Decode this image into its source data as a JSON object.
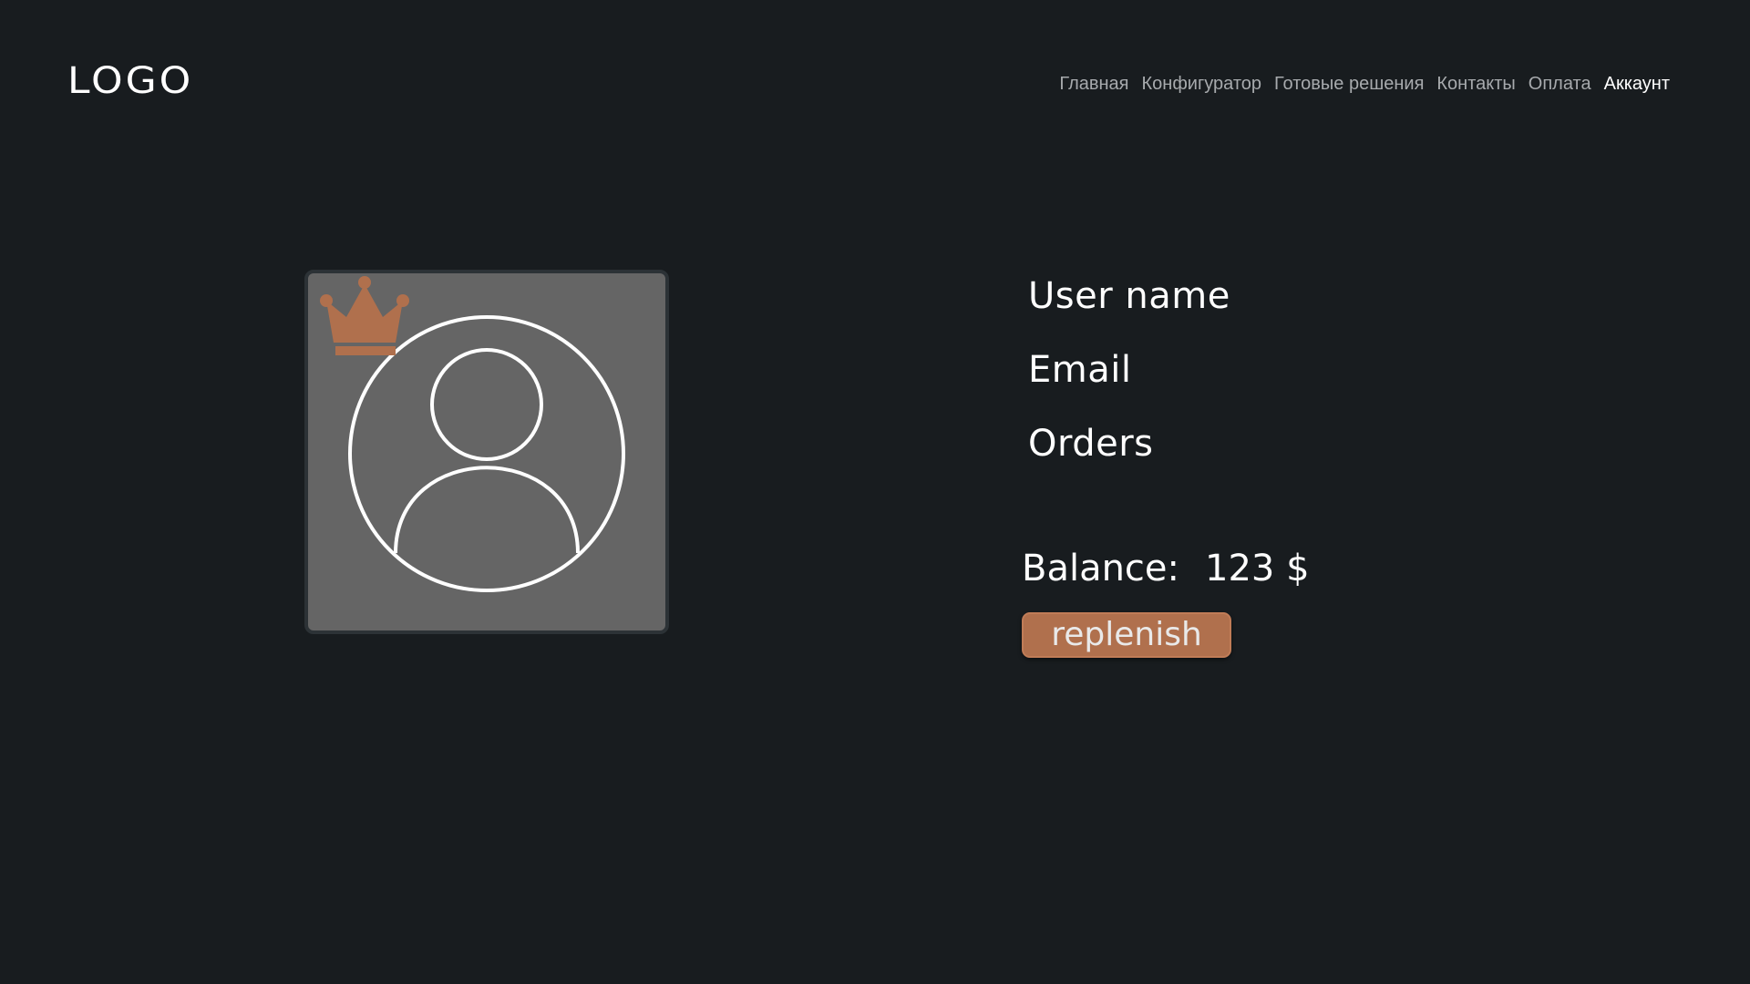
{
  "header": {
    "logo": "LOGO",
    "nav": [
      {
        "label": "Главная",
        "active": false
      },
      {
        "label": "Конфигуратор",
        "active": false
      },
      {
        "label": "Готовые решения",
        "active": false
      },
      {
        "label": "Контакты",
        "active": false
      },
      {
        "label": "Оплата",
        "active": false
      },
      {
        "label": "Аккаунт",
        "active": true
      }
    ]
  },
  "profile": {
    "avatar_icon": "user-circle-icon",
    "badge_icon": "crown-icon",
    "username_label": "User name",
    "email_label": "Email",
    "orders_label": "Orders",
    "balance_label": "Balance:",
    "balance_value": "123 $",
    "replenish_label": "replenish"
  },
  "colors": {
    "background": "#181c1f",
    "accent": "#b0704d",
    "card": "#656565",
    "nav_inactive": "#a7aaad",
    "nav_active": "#ffffff"
  }
}
